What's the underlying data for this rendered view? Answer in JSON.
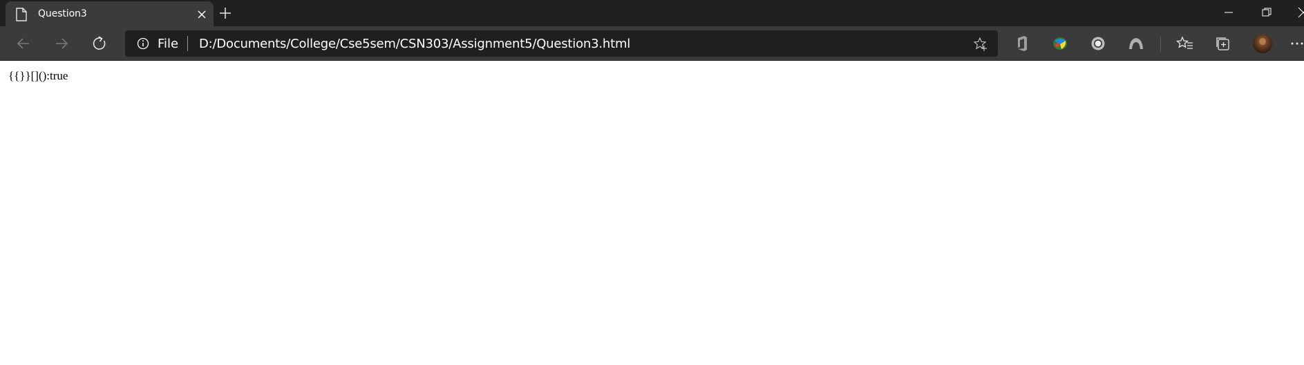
{
  "browser": {
    "tab": {
      "title": "Question3",
      "favicon": "page-icon"
    },
    "window_controls": [
      "minimize-icon",
      "restore-icon",
      "close-icon"
    ]
  },
  "toolbar": {
    "nav": [
      "back-arrow-icon",
      "forward-arrow-icon",
      "refresh-icon"
    ],
    "address": {
      "scheme_label": "File",
      "url": "D:/Documents/College/Cse5sem/CSN303/Assignment5/Question3.html"
    },
    "extensions": [
      "office-icon",
      "idm-icon",
      "circle-extension-icon",
      "arc-extension-icon"
    ],
    "actions": [
      "favorites-icon",
      "collections-icon",
      "profile-avatar",
      "more-icon"
    ]
  },
  "page": {
    "output_text": "{{}}[]():true"
  },
  "colors": {
    "tabstrip": "#202020",
    "toolbar": "#3b3b3b",
    "omnibox": "#1f1f1f",
    "page_bg": "#ffffff"
  }
}
